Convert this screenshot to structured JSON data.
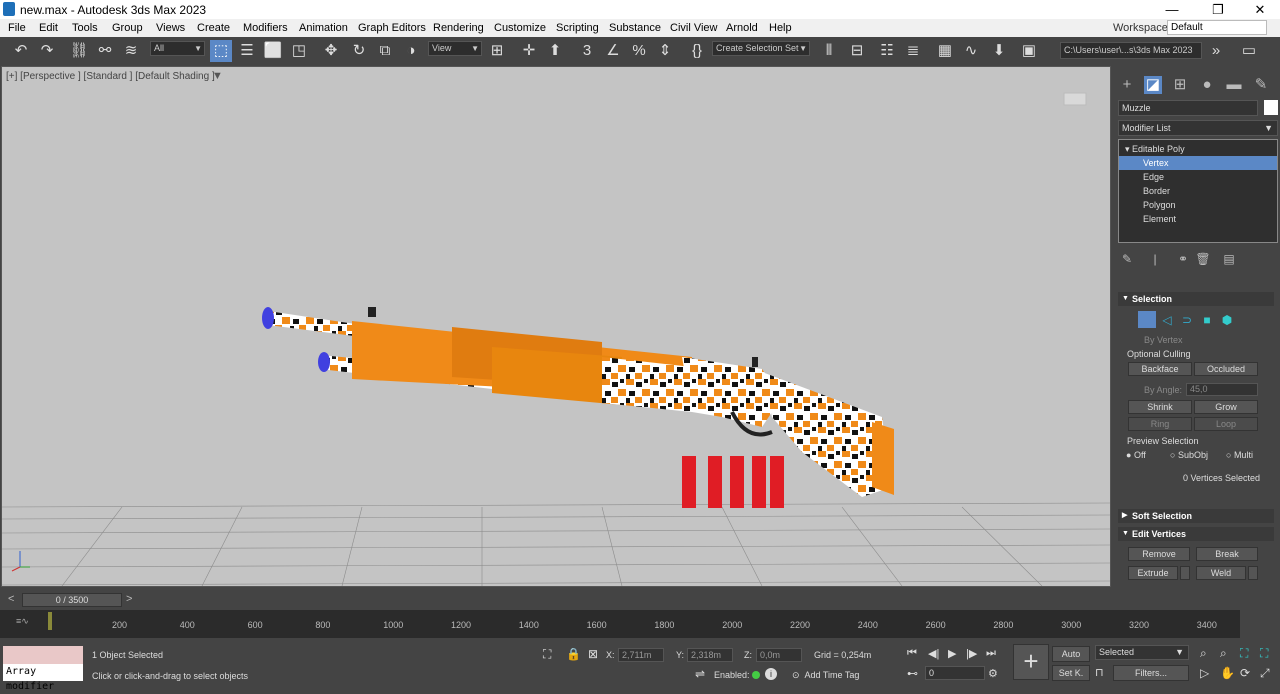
{
  "title_bar": {
    "title": "new.max - Autodesk 3ds Max 2023",
    "minimize": "—",
    "restore": "❐",
    "close": "✕"
  },
  "menu": [
    "File",
    "Edit",
    "Tools",
    "Group",
    "Views",
    "Create",
    "Modifiers",
    "Animation",
    "Graph Editors",
    "Rendering",
    "Customize",
    "Scripting",
    "Substance",
    "Civil View",
    "Arnold",
    "Help"
  ],
  "workspaces": {
    "label": "Workspaces:",
    "value": "Default"
  },
  "toolbar": {
    "filter_value": "All",
    "view_value": "View",
    "selection_set": "Create Selection Set",
    "path": "C:\\Users\\user\\...s\\3ds Max 2023",
    "angle_snap_label": "3"
  },
  "viewport": {
    "label": "[+] [Perspective ] [Standard ] [Default Shading ]"
  },
  "command_panel": {
    "object_name": "Muzzle",
    "modifier_list": "Modifier List",
    "stack": [
      "Editable Poly",
      "Vertex",
      "Edge",
      "Border",
      "Polygon",
      "Element"
    ],
    "selection_rollout": "Selection",
    "by_vertex": "By Vertex",
    "optional_culling": "Optional Culling",
    "backface": "Backface",
    "occluded": "Occluded",
    "by_angle": "By Angle:",
    "angle_value": "45,0",
    "shrink": "Shrink",
    "grow": "Grow",
    "ring": "Ring",
    "loop": "Loop",
    "preview_selection": "Preview Selection",
    "preview_off": "Off",
    "preview_subobj": "SubObj",
    "preview_multi": "Multi",
    "vertices_selected": "0 Vertices Selected",
    "soft_selection": "Soft Selection",
    "edit_vertices": "Edit Vertices",
    "remove": "Remove",
    "break": "Break",
    "extrude": "Extrude",
    "weld": "Weld"
  },
  "timeline": {
    "frame_display": "0 / 3500",
    "ticks": [
      "200",
      "400",
      "600",
      "800",
      "1000",
      "1200",
      "1400",
      "1600",
      "1800",
      "2000",
      "2200",
      "2400",
      "2600",
      "2800",
      "3000",
      "3200",
      "3400"
    ]
  },
  "status": {
    "script_listener": "Array modifier",
    "objects_selected": "1 Object Selected",
    "prompt": "Click or click-and-drag to select objects",
    "x_label": "X:",
    "x_value": "2,711m",
    "y_label": "Y:",
    "y_value": "2,318m",
    "z_label": "Z:",
    "z_value": "0,0m",
    "grid": "Grid = 0,254m",
    "enabled_label": "Enabled:",
    "add_time_tag": "Add Time Tag",
    "auto": "Auto",
    "set_key": "Set K.",
    "selected": "Selected",
    "filters": "Filters...",
    "frame": "0"
  },
  "colors": {
    "accent": "#5b88c6",
    "orange": "#f08a18",
    "shell_red": "#e01d25"
  }
}
